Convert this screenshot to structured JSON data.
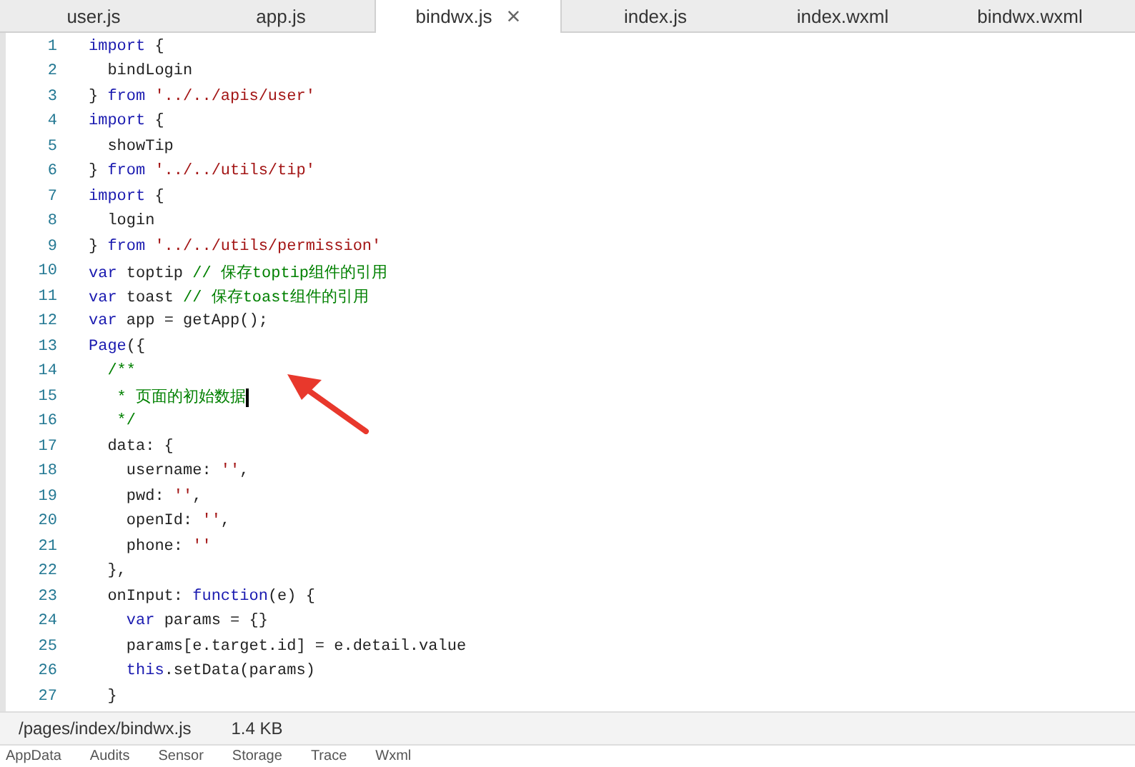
{
  "tabs": [
    {
      "label": "user.js",
      "selected": false
    },
    {
      "label": "app.js",
      "selected": false
    },
    {
      "label": "bindwx.js",
      "selected": true,
      "close": "×"
    },
    {
      "label": "index.js",
      "selected": false
    },
    {
      "label": "index.wxml",
      "selected": false
    },
    {
      "label": "bindwx.wxml",
      "selected": false
    }
  ],
  "editor": {
    "lines": [
      {
        "number": "1",
        "tokens": [
          {
            "kind": "kw",
            "text": "import"
          },
          {
            "kind": "tx",
            "text": " {"
          }
        ]
      },
      {
        "number": "2",
        "tokens": [
          {
            "kind": "tx",
            "text": "  bindLogin"
          }
        ]
      },
      {
        "number": "3",
        "tokens": [
          {
            "kind": "tx",
            "text": "} "
          },
          {
            "kind": "kw",
            "text": "from"
          },
          {
            "kind": "str",
            "text": " '../../apis/user'"
          }
        ]
      },
      {
        "number": "4",
        "tokens": [
          {
            "kind": "kw",
            "text": "import"
          },
          {
            "kind": "tx",
            "text": " {"
          }
        ]
      },
      {
        "number": "5",
        "tokens": [
          {
            "kind": "tx",
            "text": "  showTip"
          }
        ]
      },
      {
        "number": "6",
        "tokens": [
          {
            "kind": "tx",
            "text": "} "
          },
          {
            "kind": "kw",
            "text": "from"
          },
          {
            "kind": "str",
            "text": " '../../utils/tip'"
          }
        ]
      },
      {
        "number": "7",
        "tokens": [
          {
            "kind": "kw",
            "text": "import"
          },
          {
            "kind": "tx",
            "text": " {"
          }
        ]
      },
      {
        "number": "8",
        "tokens": [
          {
            "kind": "tx",
            "text": "  login"
          }
        ]
      },
      {
        "number": "9",
        "tokens": [
          {
            "kind": "tx",
            "text": "} "
          },
          {
            "kind": "kw",
            "text": "from"
          },
          {
            "kind": "str",
            "text": " '../../utils/permission'"
          }
        ]
      },
      {
        "number": "10",
        "tokens": [
          {
            "kind": "kw",
            "text": "var"
          },
          {
            "kind": "tx",
            "text": " toptip "
          },
          {
            "kind": "cm",
            "text": "// 保存toptip组件的引用"
          }
        ]
      },
      {
        "number": "11",
        "tokens": [
          {
            "kind": "kw",
            "text": "var"
          },
          {
            "kind": "tx",
            "text": " toast "
          },
          {
            "kind": "cm",
            "text": "// 保存toast组件的引用"
          }
        ]
      },
      {
        "number": "12",
        "tokens": [
          {
            "kind": "kw",
            "text": "var"
          },
          {
            "kind": "tx",
            "text": " app = getApp();"
          }
        ]
      },
      {
        "number": "13",
        "tokens": [
          {
            "kind": "kw",
            "text": "Page"
          },
          {
            "kind": "tx",
            "text": "({"
          }
        ]
      },
      {
        "number": "14",
        "tokens": [
          {
            "kind": "cm",
            "text": "  /**"
          }
        ]
      },
      {
        "number": "15",
        "tokens": [
          {
            "kind": "cm",
            "text": "   * 页面的初始数据"
          },
          {
            "kind": "caret"
          }
        ]
      },
      {
        "number": "16",
        "tokens": [
          {
            "kind": "cm",
            "text": "   */"
          }
        ]
      },
      {
        "number": "17",
        "tokens": [
          {
            "kind": "tx",
            "text": "  data: {"
          }
        ]
      },
      {
        "number": "18",
        "tokens": [
          {
            "kind": "tx",
            "text": "    username: "
          },
          {
            "kind": "str",
            "text": "''"
          },
          {
            "kind": "tx",
            "text": ","
          }
        ]
      },
      {
        "number": "19",
        "tokens": [
          {
            "kind": "tx",
            "text": "    pwd: "
          },
          {
            "kind": "str",
            "text": "''"
          },
          {
            "kind": "tx",
            "text": ","
          }
        ]
      },
      {
        "number": "20",
        "tokens": [
          {
            "kind": "tx",
            "text": "    openId: "
          },
          {
            "kind": "str",
            "text": "''"
          },
          {
            "kind": "tx",
            "text": ","
          }
        ]
      },
      {
        "number": "21",
        "tokens": [
          {
            "kind": "tx",
            "text": "    phone: "
          },
          {
            "kind": "str",
            "text": "''"
          }
        ]
      },
      {
        "number": "22",
        "tokens": [
          {
            "kind": "tx",
            "text": "  },"
          }
        ]
      },
      {
        "number": "23",
        "tokens": [
          {
            "kind": "tx",
            "text": "  onInput: "
          },
          {
            "kind": "kw",
            "text": "function"
          },
          {
            "kind": "tx",
            "text": "(e) {"
          }
        ]
      },
      {
        "number": "24",
        "tokens": [
          {
            "kind": "kw",
            "text": "    var"
          },
          {
            "kind": "tx",
            "text": " params = {}"
          }
        ]
      },
      {
        "number": "25",
        "tokens": [
          {
            "kind": "tx",
            "text": "    params[e.target.id] = e.detail.value"
          }
        ]
      },
      {
        "number": "26",
        "tokens": [
          {
            "kind": "kw",
            "text": "    this"
          },
          {
            "kind": "tx",
            "text": ".setData(params)"
          }
        ]
      },
      {
        "number": "27",
        "tokens": [
          {
            "kind": "tx",
            "text": "  }"
          }
        ]
      }
    ]
  },
  "status_bar": {
    "path": "/pages/index/bindwx.js",
    "size": "1.4 KB"
  },
  "panel_tabs": [
    "AppData",
    "Audits",
    "Sensor",
    "Storage",
    "Trace",
    "Wxml"
  ]
}
